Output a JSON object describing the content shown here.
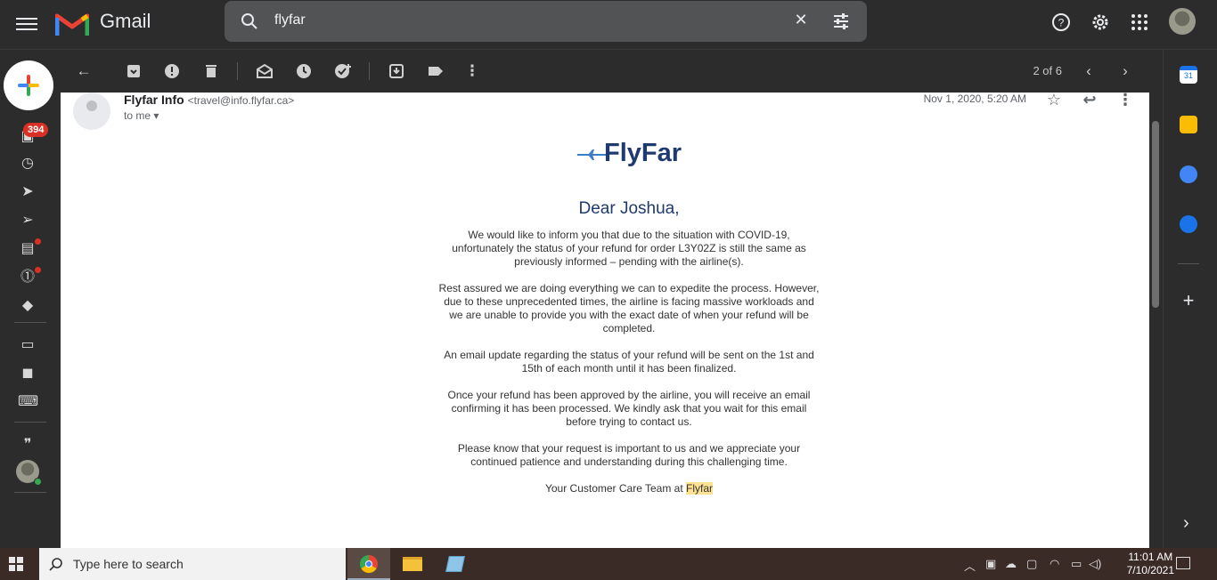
{
  "app": {
    "name": "Gmail"
  },
  "search": {
    "query": "flyfar"
  },
  "toolbar": {
    "pager": "2 of 6"
  },
  "leftrail": {
    "inbox_badge": "394"
  },
  "email": {
    "sender_name": "Flyfar Info",
    "sender_email": "<travel@info.flyfar.ca>",
    "to": "to me",
    "date": "Nov 1, 2020, 5:20 AM",
    "logo_text": "FlyFar",
    "greeting": "Dear Joshua,",
    "paragraphs": [
      "We would like to inform you that due to the situation with COVID-19, unfortunately the status of your refund for order L3Y02Z is still the same as previously informed – pending with the airline(s).",
      "Rest assured we are doing everything we can to expedite the process. However, due to these unprecedented times, the airline is facing massive workloads and we are unable to provide you with the exact date of when your refund will be completed.",
      "An email update regarding the status of your refund will be sent on the 1st and 15th of each month until it has been finalized.",
      "Once your refund has been approved by the airline, you will receive an email confirming it has been processed. We kindly ask that you wait for this email before trying to contact us.",
      "Please know that your request is important to us and we appreciate your continued patience and understanding during this challenging time."
    ],
    "signoff_prefix": "Your Customer Care Team at ",
    "signoff_highlight": "Flyfar"
  },
  "taskbar": {
    "search_placeholder": "Type here to search",
    "time": "11:01 AM",
    "date": "7/10/2021"
  },
  "colors": {
    "accent": "#1e3a6e",
    "badge": "#d93025",
    "highlight": "#fde293"
  }
}
